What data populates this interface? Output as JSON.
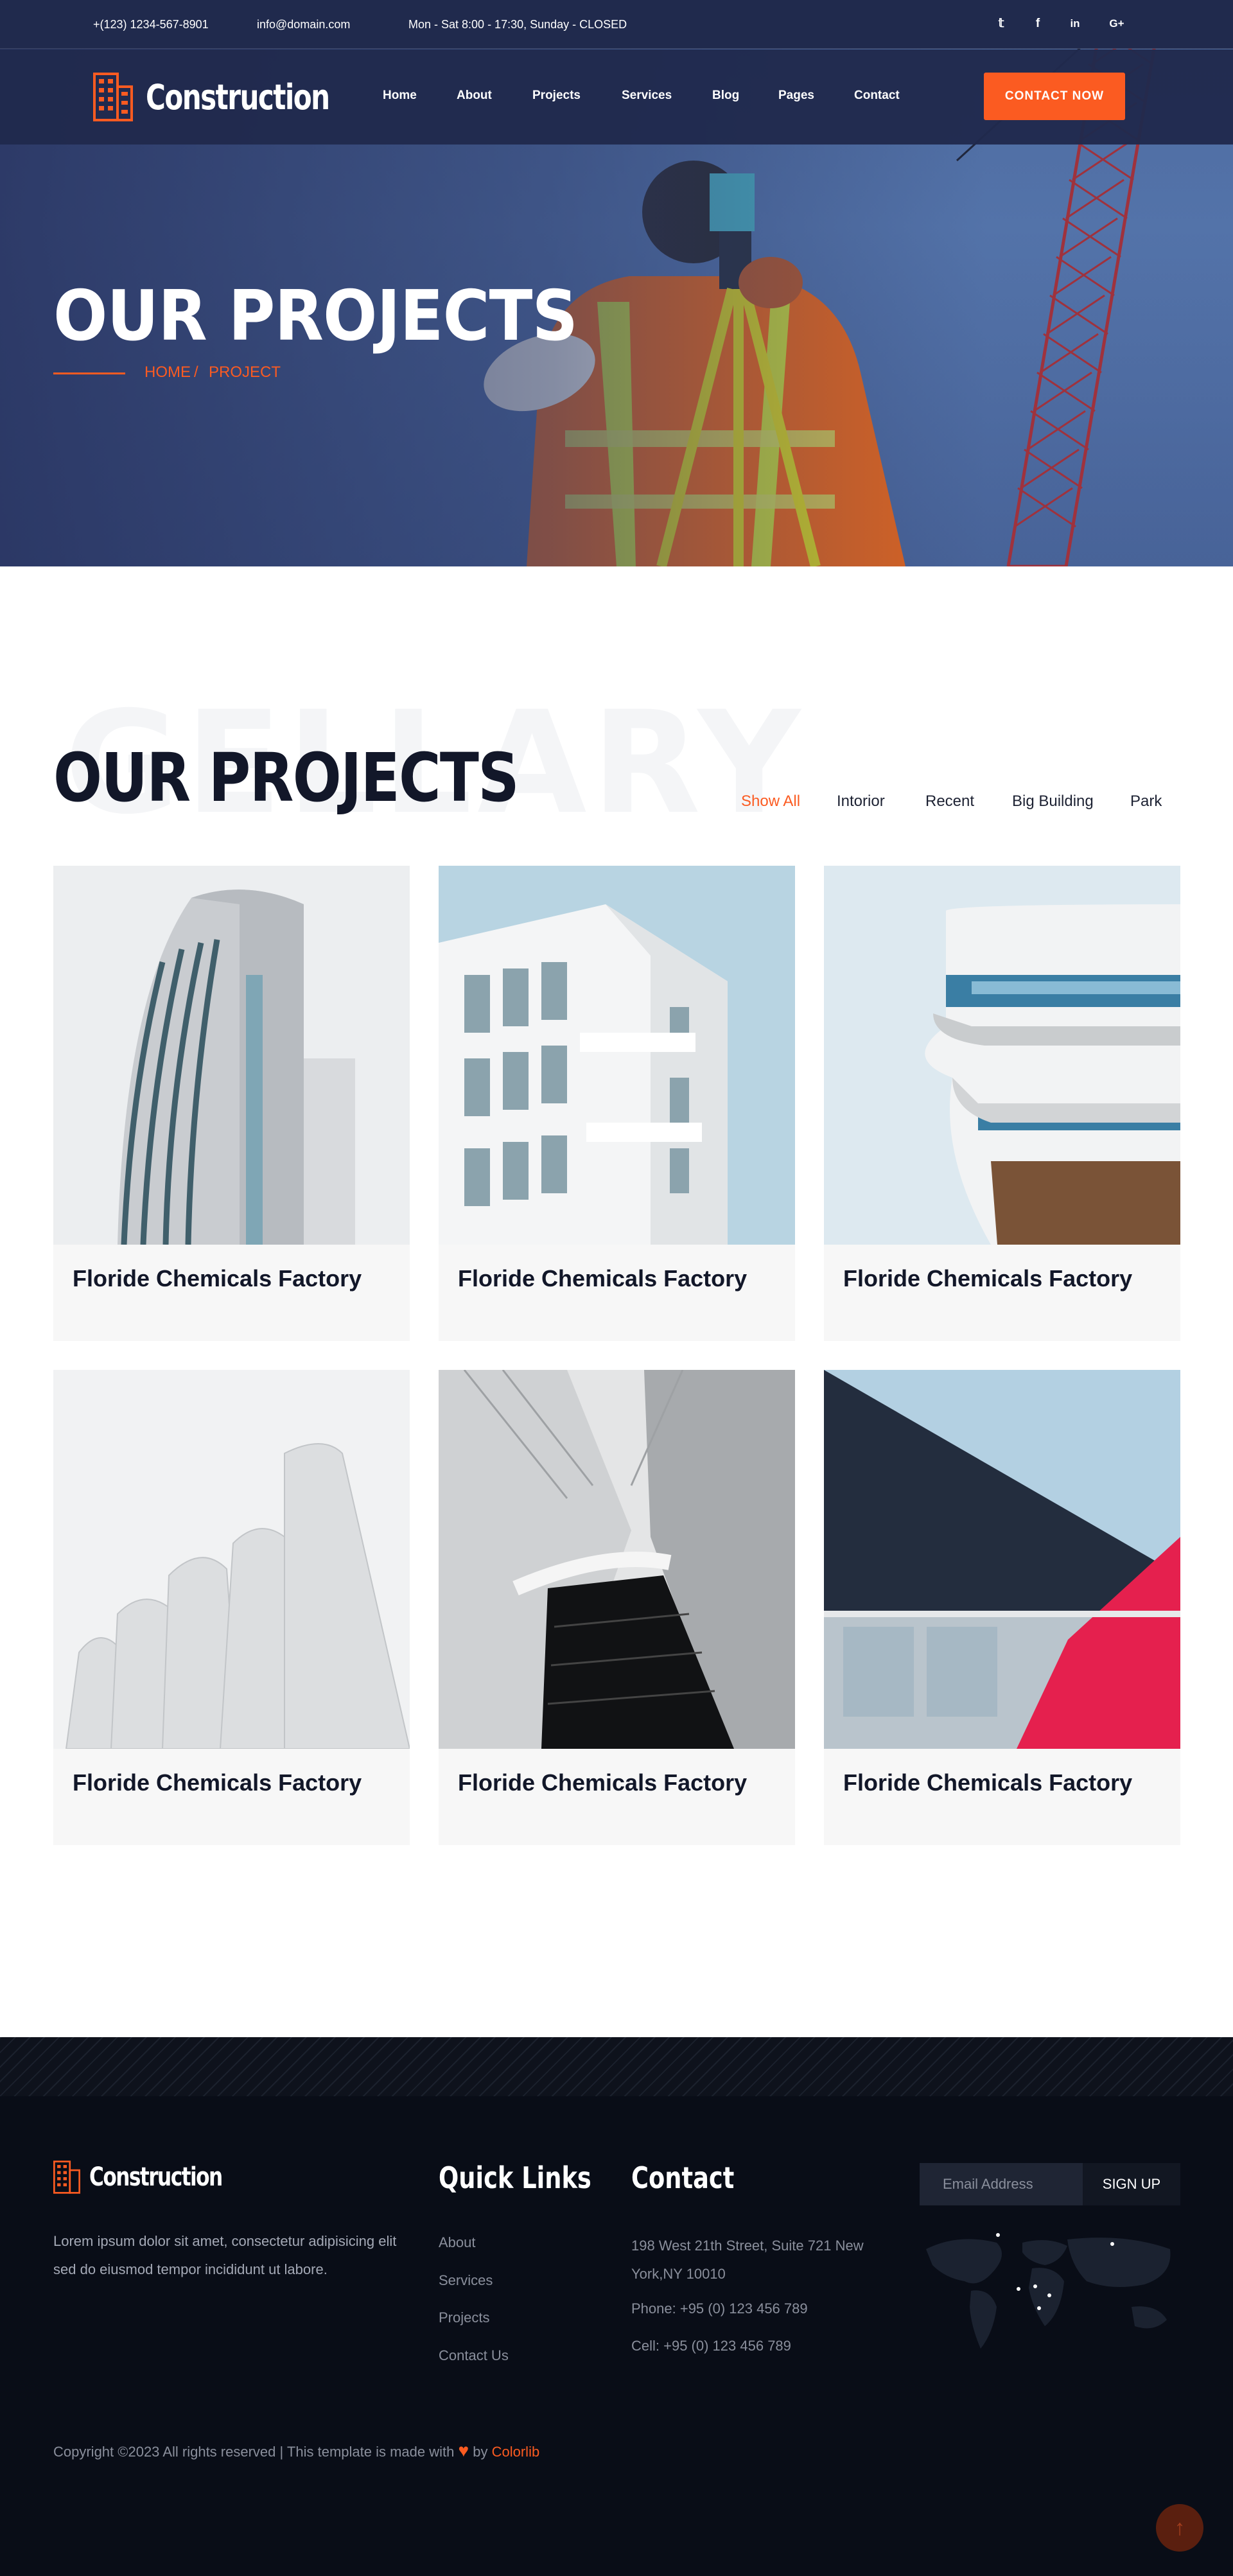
{
  "topbar": {
    "phone": "+(123) 1234-567-8901",
    "email": "info@domain.com",
    "hours": "Mon - Sat 8:00 - 17:30, Sunday - CLOSED",
    "social": [
      "twitter-icon",
      "facebook-icon",
      "linkedin-icon",
      "google-plus-icon"
    ]
  },
  "brand": {
    "name": "Construction"
  },
  "nav": {
    "items": [
      "Home",
      "About",
      "Projects",
      "Services",
      "Blog",
      "Pages",
      "Contact"
    ],
    "cta": "CONTACT NOW"
  },
  "hero": {
    "title": "OUR PROJECTS",
    "breadcrumb": [
      "HOME",
      "/",
      "PROJECT"
    ]
  },
  "projects": {
    "ghost": "GELLARY",
    "title": "OUR PROJECTS",
    "filters": [
      "Show All",
      "Intorior",
      "Recent",
      "Big Building",
      "Park"
    ],
    "active_filter": "Show All",
    "cards": [
      "Floride Chemicals Factory",
      "Floride Chemicals Factory",
      "Floride Chemicals Factory",
      "Floride Chemicals Factory",
      "Floride Chemicals Factory",
      "Floride Chemicals Factory"
    ]
  },
  "footer": {
    "brand": "Construction",
    "description": "Lorem ipsum dolor sit amet, consectetur adipisicing elit sed do eiusmod tempor incididunt ut labore.",
    "quick_links_title": "Quick Links",
    "quick_links": [
      "About",
      "Services",
      "Projects",
      "Contact Us"
    ],
    "contact_title": "Contact",
    "address_line1": "198 West 21th Street, Suite 721 New",
    "address_line2": "York,NY 10010",
    "phone": "Phone: +95 (0) 123 456 789",
    "cell": "Cell: +95 (0) 123 456 789",
    "email_placeholder": "Email Address",
    "signup": "SIGN UP",
    "copyright_prefix": "Copyright ©2023 All rights reserved | This template is made with",
    "copyright_by": "by",
    "copyright_brand": "Colorlib"
  },
  "colors": {
    "accent": "#fb5b21",
    "navy": "#202a4d",
    "dark": "#090d17",
    "title": "#121729"
  }
}
